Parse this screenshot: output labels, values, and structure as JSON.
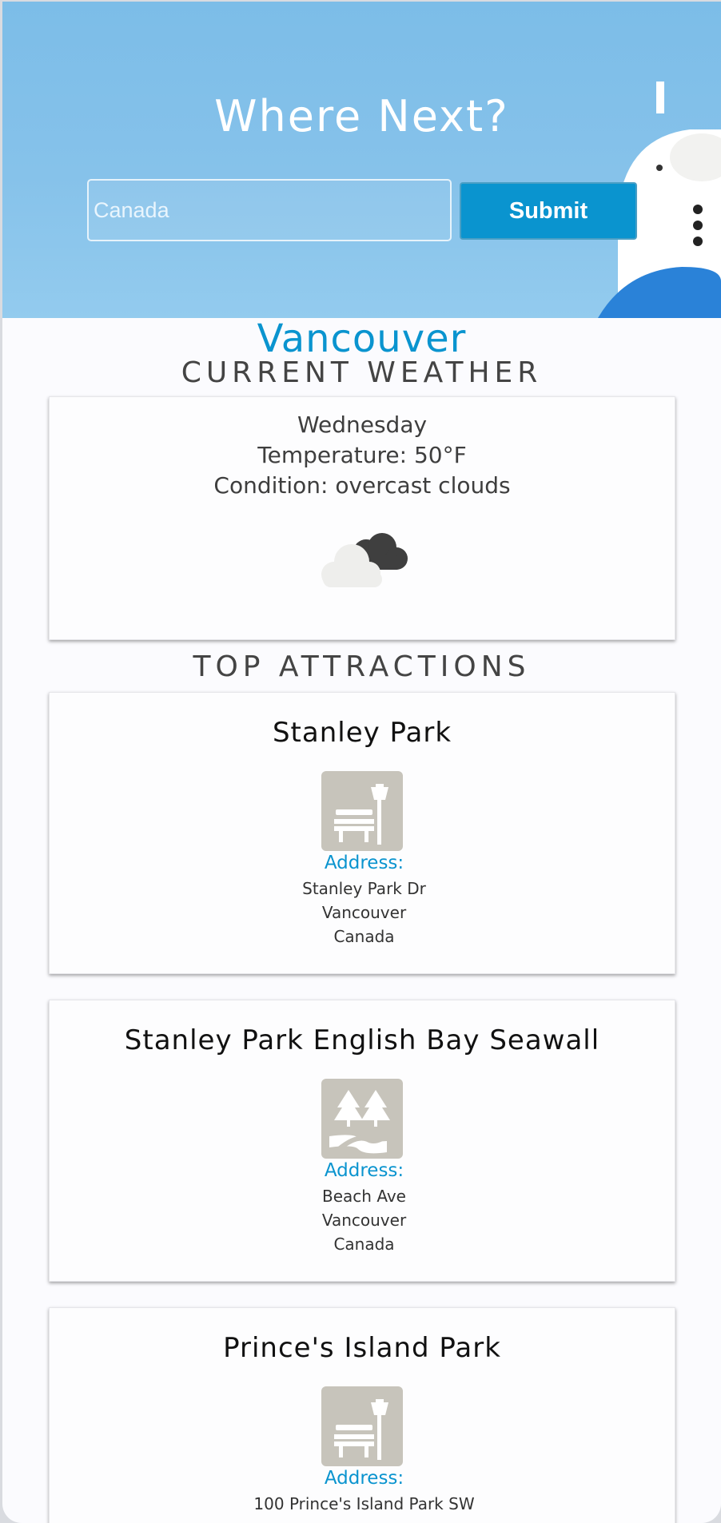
{
  "hero": {
    "title": "Where Next?",
    "search_placeholder": "Canada",
    "submit_label": "Submit"
  },
  "city": "Vancouver",
  "weather": {
    "section_title": "CURRENT WEATHER",
    "day": "Wednesday",
    "temperature": "Temperature: 50°F",
    "condition": "Condition: overcast clouds",
    "icon": "overcast-clouds-icon"
  },
  "attractions": {
    "section_title": "TOP ATTRACTIONS",
    "address_label": "Address:",
    "items": [
      {
        "name": "Stanley Park",
        "icon": "park-bench-icon",
        "address": [
          "Stanley Park Dr",
          "Vancouver",
          "Canada"
        ]
      },
      {
        "name": "Stanley Park English Bay Seawall",
        "icon": "trail-trees-icon",
        "address": [
          "Beach Ave",
          "Vancouver",
          "Canada"
        ]
      },
      {
        "name": "Prince's Island Park",
        "icon": "park-bench-icon",
        "address": [
          "100 Prince's Island Park SW"
        ]
      }
    ]
  },
  "colors": {
    "accent": "#0a94cf",
    "sky": "#7cbde8",
    "icon_bg": "#c7c4bb"
  }
}
